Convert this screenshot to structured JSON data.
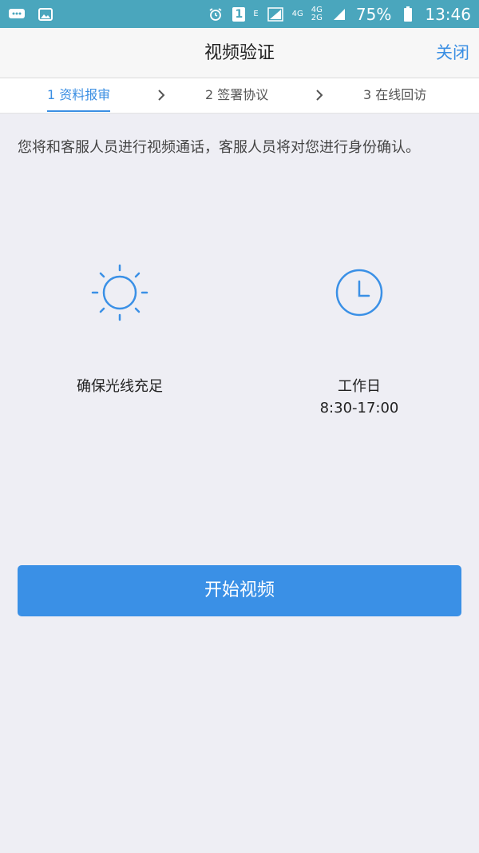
{
  "status_bar": {
    "network_e": "E",
    "network_4g_a": "4G",
    "network_4g_b": "4G",
    "network_2g": "2G",
    "battery_percent": "75%",
    "time": "13:46",
    "sim_badge": "1"
  },
  "header": {
    "title": "视频验证",
    "close_label": "关闭"
  },
  "steps": [
    {
      "label": "1 资料报审",
      "active": true
    },
    {
      "label": "2 签署协议",
      "active": false
    },
    {
      "label": "3 在线回访",
      "active": false
    }
  ],
  "main": {
    "intro": "您将和客服人员进行视频通话，客服人员将对您进行身份确认。",
    "features": [
      {
        "icon": "sun-icon",
        "label": "确保光线充足",
        "sub": ""
      },
      {
        "icon": "clock-icon",
        "label": "工作日",
        "sub": "8:30-17:00"
      }
    ],
    "start_button": "开始视频"
  },
  "colors": {
    "accent": "#3a90e6",
    "status_bar": "#4aa6bd",
    "background": "#eeeef4"
  }
}
